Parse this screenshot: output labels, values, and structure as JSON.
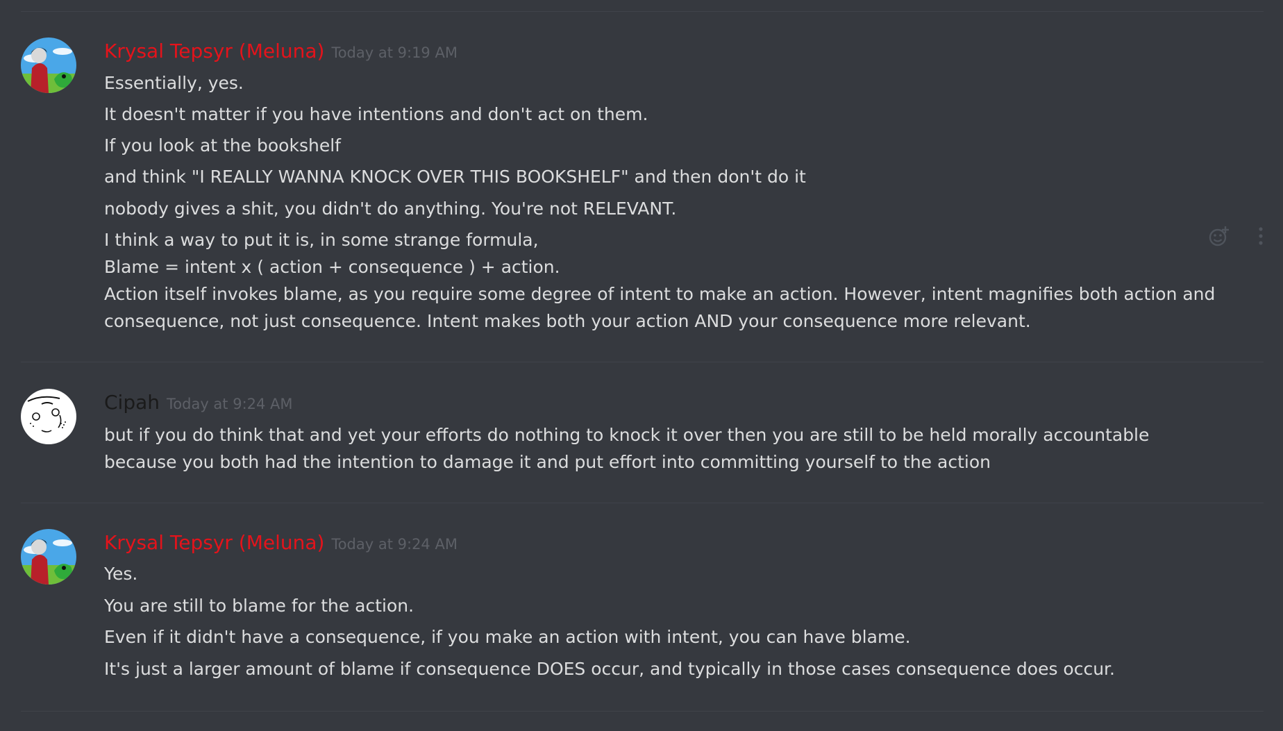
{
  "colors": {
    "background": "#36393f",
    "meluna_name": "#e4131b",
    "cipah_name": "#1a1a1a",
    "timestamp": "#5d6067",
    "text": "#dcddde"
  },
  "messages": [
    {
      "author": "Krysal Tepsyr (Meluna)",
      "timestamp": "Today at 9:19 AM",
      "lines": [
        "Essentially, yes.",
        "It doesn't matter if you have intentions and don't act on them.",
        "If you look at the bookshelf",
        "and think \"I REALLY WANNA KNOCK OVER THIS BOOKSHELF\" and then don't do it",
        "nobody gives a shit, you didn't do anything. You're not RELEVANT.",
        "I think a way to put it is, in some strange formula,",
        "Blame = intent x ( action + consequence ) + action.",
        "Action itself invokes blame, as you require some degree of intent to make an action. However, intent magnifies both action and consequence, not just consequence. Intent makes both your action AND your consequence more relevant."
      ]
    },
    {
      "author": "Cipah",
      "timestamp": "Today at 9:24 AM",
      "lines": [
        "but if you do think that and yet your efforts do nothing to knock it over then you are still to be held morally accountable because you both had the intention to damage it and put effort into committing yourself to the action"
      ]
    },
    {
      "author": "Krysal Tepsyr (Meluna)",
      "timestamp": "Today at 9:24 AM",
      "lines": [
        "Yes.",
        "You are still to blame for the action.",
        "Even if it didn't have a consequence, if you make an action with intent, you can have blame.",
        "It's just a larger amount of blame if consequence DOES occur, and typically in those cases consequence does occur."
      ]
    }
  ],
  "hover_actions": {
    "reaction_icon": "add-reaction-icon",
    "more_icon": "more-options-icon"
  }
}
